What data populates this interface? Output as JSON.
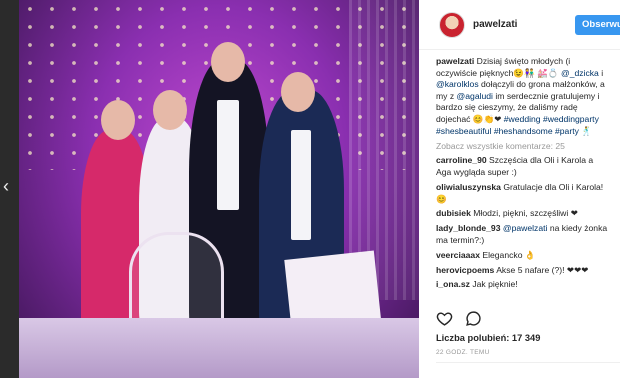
{
  "post": {
    "username": "pawelzati",
    "follow_label": "Obserwuj",
    "caption_user": "pawelzati",
    "caption_parts": [
      {
        "t": "Dzisiaj święto młodych (i oczywiście pięknych",
        "link": false
      },
      {
        "t": "😉👫",
        "link": false
      },
      {
        "t": " 💒💍 ",
        "link": false
      },
      {
        "t": "@_dzicka",
        "link": true
      },
      {
        "t": " i ",
        "link": false
      },
      {
        "t": "@karolklos",
        "link": true
      },
      {
        "t": " dołączyli do grona małżonków, a my z ",
        "link": false
      },
      {
        "t": "@agaludi",
        "link": true
      },
      {
        "t": " im serdecznie gratulujemy i bardzo się cieszymy, że daliśmy radę dojechać 😊👏❤ ",
        "link": false
      },
      {
        "t": "#wedding",
        "link": true
      },
      {
        "t": " ",
        "link": false
      },
      {
        "t": "#weddingparty",
        "link": true
      },
      {
        "t": " ",
        "link": false
      },
      {
        "t": "#shesbeautiful",
        "link": true
      },
      {
        "t": " ",
        "link": false
      },
      {
        "t": "#heshandsome",
        "link": true
      },
      {
        "t": " ",
        "link": false
      },
      {
        "t": "#party",
        "link": true
      },
      {
        "t": " 🕺",
        "link": false
      }
    ],
    "view_all": "Zobacz wszystkie komentarze: 25",
    "comments": [
      {
        "user": "carroline_90",
        "text": "Szczęścia dla Oli i Karola a Aga wygląda super :)",
        "mention": ""
      },
      {
        "user": "oliwialuszynska",
        "text": "Gratulacje dla Oli i Karola! 😊",
        "mention": ""
      },
      {
        "user": "dubisiek",
        "text": "Młodzi, piękni, szczęśliwi ❤",
        "mention": ""
      },
      {
        "user": "lady_blonde_93",
        "text": " na kiedy żonka ma termin?:)",
        "mention": "@pawelzati"
      },
      {
        "user": "veerciaaax",
        "text": "Elegancko 👌",
        "mention": ""
      },
      {
        "user": "herovicpoems",
        "text": "Akse 5 nafare (?)! ❤❤❤",
        "mention": ""
      },
      {
        "user": "i_ona.sz",
        "text": "Jak pięknie!",
        "mention": ""
      }
    ],
    "likes": "Liczba polubień: 17 349",
    "time": "22 GODZ. TEMU"
  },
  "nav": {
    "prev_arrow": "‹"
  },
  "icons": {
    "like": "heart-icon",
    "comment": "comment-icon"
  },
  "colors": {
    "follow_button": "#3897f0",
    "link": "#003569"
  }
}
